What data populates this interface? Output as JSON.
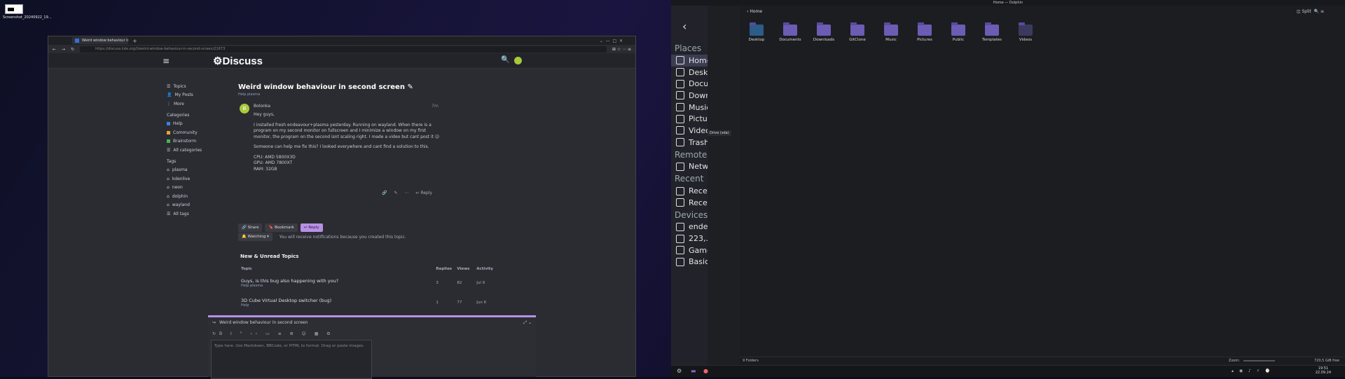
{
  "desktop": {
    "icon_label": "Screenshot_20240922_19..."
  },
  "browser": {
    "tab_title": "Weird window behaviour in s...",
    "url": "https://discuss.kde.org/t/weird-window-behaviour-in-second-screen/21673",
    "site_name": "Discuss",
    "sidebar": {
      "top": [
        "Topics",
        "My Posts",
        "More"
      ],
      "categories_heading": "Categories",
      "categories": [
        {
          "label": "Help",
          "color": "#3b82d6"
        },
        {
          "label": "Community",
          "color": "#e8a33b"
        },
        {
          "label": "Brainstorm",
          "color": "#3fb950"
        },
        {
          "label": "All categories",
          "color": ""
        }
      ],
      "tags_heading": "Tags",
      "tags": [
        "plasma",
        "kdenlive",
        "neon",
        "dolphin",
        "wayland",
        "All tags"
      ]
    },
    "topic": {
      "title": "Weird window behaviour in second screen",
      "crumb": "Help  plasma"
    },
    "post": {
      "author": "Bolonka",
      "avatar_letter": "B",
      "age": "7m",
      "paras": [
        "Hey guys,",
        "I installed fresh endeavour+plasma yesterday. Running on wayland. When there is a program on my second monitor on fullscreen and I minimize a window on my first monitor, the program on the second isnt scaling right. I made a video but cant post it 😕",
        "Someone can help me fix this? I looked everywhere and cant find a solution to this.",
        "CPU: AMD 5800X3D",
        "GPU: AMD 7800XT",
        "RAM: 32GB"
      ],
      "reply_label": "Reply"
    },
    "actions": {
      "share": "Share",
      "bookmark": "Bookmark",
      "reply": "Reply"
    },
    "watching": {
      "label": "Watching",
      "note": "You will receive notifications because you created this topic."
    },
    "new_unread": {
      "heading": "New & Unread Topics",
      "cols": [
        "Topic",
        "Replies",
        "Views",
        "Activity"
      ],
      "rows": [
        {
          "title": "Guys, is this bug also happening with you?",
          "tags": "Help  plasma",
          "replies": "3",
          "views": "82",
          "activity": "Jul 9"
        },
        {
          "title": "3D Cube Virtual Desktop switcher (bug)",
          "tags": "Help",
          "replies": "1",
          "views": "77",
          "activity": "Jun 6"
        }
      ]
    },
    "compose": {
      "title": "Weird window behaviour in second screen",
      "placeholder": "Type here. Use Markdown, BBCode, or HTML to format. Drag or paste images."
    }
  },
  "dolphin": {
    "title": "Home — Dolphin",
    "breadcrumb": "Home",
    "split_label": "Split",
    "places_heading": "Places",
    "places": [
      "Home",
      "Desktop",
      "Documents",
      "Downloads",
      "Music",
      "Pictures",
      "Videos",
      "Trash"
    ],
    "remote_heading": "Remote",
    "remote": [
      "Network"
    ],
    "recent_heading": "Recent",
    "recent": [
      "Recent Files",
      "Recent Locations"
    ],
    "devices_heading": "Devices",
    "devices": [
      "endeavouros",
      "223,...",
      "Games",
      "Basic..."
    ],
    "tooltip": "Drive (sda)",
    "folders": [
      "Desktop",
      "Documents",
      "Downloads",
      "GitClone",
      "Music",
      "Pictures",
      "Public",
      "Templates",
      "Videos"
    ],
    "status": "9 Folders",
    "zoom_label": "Zoom:",
    "free_space": "720,5 GiB free",
    "clock_time": "19:51",
    "clock_date": "22.09.24"
  }
}
